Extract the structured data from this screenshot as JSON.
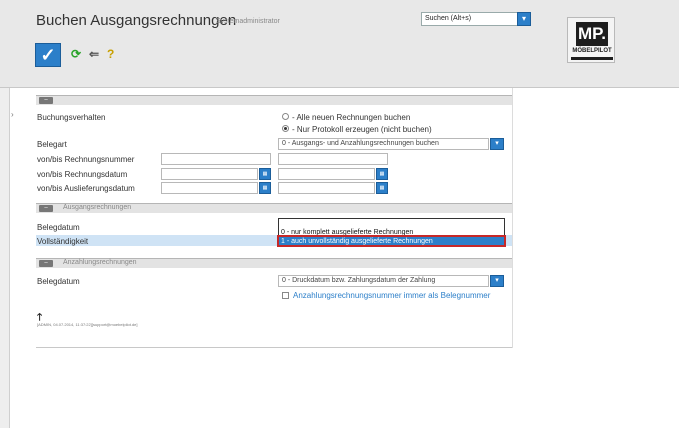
{
  "header": {
    "title": "Buchen Ausgangsrechnungen",
    "user": "Systemadministrator",
    "search_placeholder": "Suchen (Alt+s)"
  },
  "logo": {
    "mark": "MP.",
    "text": "MÖBELPILOT"
  },
  "toolbar": {
    "confirm_icon": "check-icon",
    "refresh_icon": "refresh-icon",
    "back_icon": "back-arrow-icon",
    "help_icon": "help-icon"
  },
  "section1": {
    "title": "",
    "buchungsverhalten_label": "Buchungsverhalten",
    "radio_option_1": "- Alle neuen Rechnungen buchen",
    "radio_option_2": "- Nur Protokoll erzeugen (nicht buchen)",
    "radio_selected": 2,
    "belegart_label": "Belegart",
    "belegart_value": "0 - Ausgangs- und Anzahlungsrechnungen buchen",
    "rechnungsnummer_label": "von/bis Rechnungsnummer",
    "rechnungsdatum_label": "von/bis Rechnungsdatum",
    "auslieferungsdatum_label": "von/bis Auslieferungsdatum"
  },
  "section2": {
    "title": "Ausgangsrechnungen",
    "belegdatum_label": "Belegdatum",
    "vollstaendigkeit_label": "Vollständigkeit",
    "dropdown_options": [
      "0 - nur komplett ausgelieferte Rechnungen",
      "1 - auch unvollständig ausgelieferte Rechnungen"
    ]
  },
  "section3": {
    "title": "Anzahlungsrechnungen",
    "belegdatum_label": "Belegdatum",
    "belegdatum_value": "0 - Druckdatum bzw. Zahlungsdatum der Zahlung",
    "checkbox_label": "Anzahlungsrechnungsnummer immer als Belegnummer"
  },
  "footer": {
    "meta": "[ADMIN, 04.07.2014, 11:37:22][support@moebelpilot.de]"
  },
  "colors": {
    "accent": "#2c7fc9",
    "highlight": "#cfe3f5",
    "red_frame": "#c62828"
  }
}
